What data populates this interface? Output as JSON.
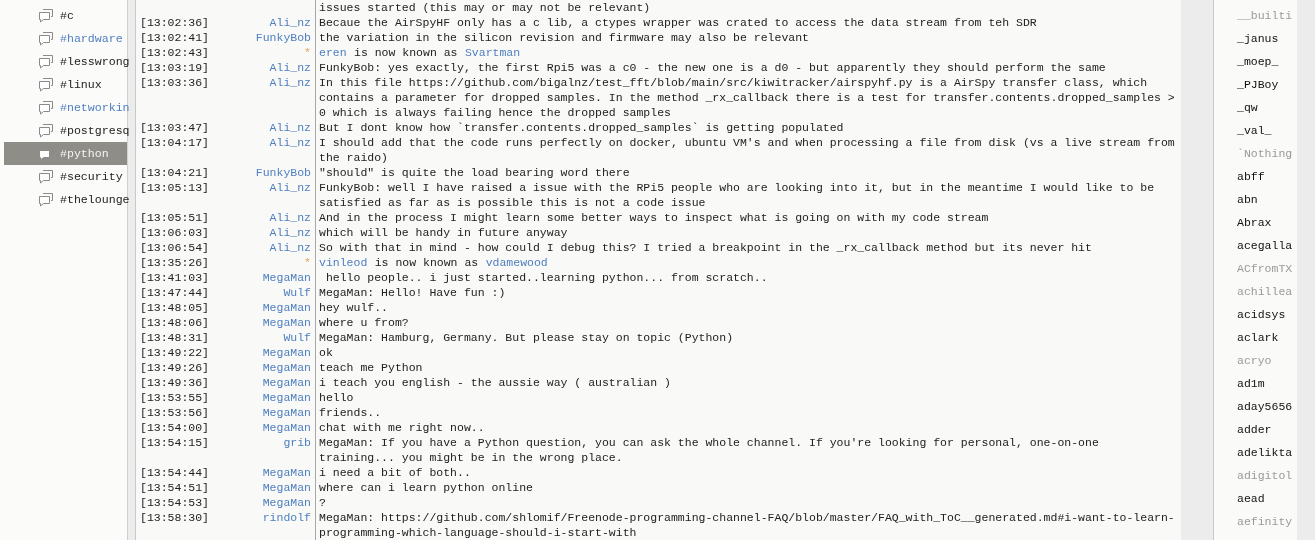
{
  "channels": [
    {
      "name": "#c",
      "highlighted": false,
      "selected": false
    },
    {
      "name": "#hardware",
      "highlighted": true,
      "selected": false
    },
    {
      "name": "#lesswrong",
      "highlighted": false,
      "selected": false
    },
    {
      "name": "#linux",
      "highlighted": false,
      "selected": false
    },
    {
      "name": "#networkin",
      "highlighted": true,
      "selected": false
    },
    {
      "name": "#postgresq",
      "highlighted": false,
      "selected": false
    },
    {
      "name": "#python",
      "highlighted": false,
      "selected": true
    },
    {
      "name": "#security",
      "highlighted": false,
      "selected": false
    },
    {
      "name": "#thelounge",
      "highlighted": false,
      "selected": false
    }
  ],
  "messages": [
    {
      "kind": "continuation",
      "text": "issues started (this may or may not be relevant)"
    },
    {
      "kind": "message",
      "time": "[13:02:36]",
      "nick": "Ali_nz",
      "text": "Becaue the AirSpyHF only has a c lib, a ctypes wrapper was crated to access the data stream from teh SDR"
    },
    {
      "kind": "message",
      "time": "[13:02:41]",
      "nick": "FunkyBob",
      "text": "the variation in the silicon revision and firmware may also be relevant"
    },
    {
      "kind": "nick_change",
      "time": "[13:02:43]",
      "nick": "*",
      "old": "eren",
      "text": "is now known as",
      "new": "Svartman"
    },
    {
      "kind": "message",
      "time": "[13:03:19]",
      "nick": "Ali_nz",
      "text": "FunkyBob: yes exactly, the first Rpi5 was a c0 - the new one is a d0 - but apparently they should perform the same"
    },
    {
      "kind": "message",
      "time": "[13:03:36]",
      "nick": "Ali_nz",
      "text": "In this file https://github.com/bigalnz/test_fft/blob/main/src/kiwitracker/airspyhf.py is a AirSpy transfer class, which contains a parameter for dropped samples. In the method _rx_callback there is a test for transfer.contents.dropped_samples > 0 which is always failing hence the dropped samples"
    },
    {
      "kind": "message",
      "time": "[13:03:47]",
      "nick": "Ali_nz",
      "text": "But I dont know how `transfer.contents.dropped_samples` is getting populated"
    },
    {
      "kind": "message",
      "time": "[13:04:17]",
      "nick": "Ali_nz",
      "text": "I should add that the code runs perfectly on docker, ubuntu VM's and when processing a file from disk (vs a live stream from the raido)"
    },
    {
      "kind": "message",
      "time": "[13:04:21]",
      "nick": "FunkyBob",
      "text": "\"should\" is quite the load bearing word there"
    },
    {
      "kind": "message",
      "time": "[13:05:13]",
      "nick": "Ali_nz",
      "text": "FunkyBob: well I have raised a issue with the RPi5 people who are looking into it, but in the meantime I would like to be satisfied as far as is possible this is not a code issue"
    },
    {
      "kind": "message",
      "time": "[13:05:51]",
      "nick": "Ali_nz",
      "text": "And in the process I might learn some better ways to inspect what is going on with my code stream"
    },
    {
      "kind": "message",
      "time": "[13:06:03]",
      "nick": "Ali_nz",
      "text": "which will be handy in future anyway"
    },
    {
      "kind": "message",
      "time": "[13:06:54]",
      "nick": "Ali_nz",
      "text": "So with that in mind - how could I debug this? I tried a breakpoint in the _rx_callback method but its never hit"
    },
    {
      "kind": "nick_change",
      "time": "[13:35:26]",
      "nick": "*",
      "old": "vinleod",
      "text": "is now known as",
      "new": "vdamewood"
    },
    {
      "kind": "message",
      "time": "[13:41:03]",
      "nick": "MegaMan",
      "text": " hello people.. i just started..learning python... from scratch.."
    },
    {
      "kind": "message",
      "time": "[13:47:44]",
      "nick": "Wulf",
      "text": "MegaMan: Hello! Have fun :)"
    },
    {
      "kind": "message",
      "time": "[13:48:05]",
      "nick": "MegaMan",
      "text": "hey wulf.."
    },
    {
      "kind": "message",
      "time": "[13:48:06]",
      "nick": "MegaMan",
      "text": "where u from?"
    },
    {
      "kind": "message",
      "time": "[13:48:31]",
      "nick": "Wulf",
      "text": "MegaMan: Hamburg, Germany. But please stay on topic (Python)"
    },
    {
      "kind": "message",
      "time": "[13:49:22]",
      "nick": "MegaMan",
      "text": "ok"
    },
    {
      "kind": "message",
      "time": "[13:49:26]",
      "nick": "MegaMan",
      "text": "teach me Python"
    },
    {
      "kind": "message",
      "time": "[13:49:36]",
      "nick": "MegaMan",
      "text": "i teach you english - the aussie way ( australian )"
    },
    {
      "kind": "message",
      "time": "[13:53:55]",
      "nick": "MegaMan",
      "text": "hello"
    },
    {
      "kind": "message",
      "time": "[13:53:56]",
      "nick": "MegaMan",
      "text": "friends.."
    },
    {
      "kind": "message",
      "time": "[13:54:00]",
      "nick": "MegaMan",
      "text": "chat with me right now.."
    },
    {
      "kind": "message",
      "time": "[13:54:15]",
      "nick": "grib",
      "text": "MegaMan: If you have a Python question, you can ask the whole channel. If you're looking for personal, one-on-one training... you might be in the wrong place."
    },
    {
      "kind": "message",
      "time": "[13:54:44]",
      "nick": "MegaMan",
      "text": "i need a bit of both.."
    },
    {
      "kind": "message",
      "time": "[13:54:51]",
      "nick": "MegaMan",
      "text": "where can i learn python online"
    },
    {
      "kind": "message",
      "time": "[13:54:53]",
      "nick": "MegaMan",
      "text": "?"
    },
    {
      "kind": "message",
      "time": "[13:58:30]",
      "nick": "rindolf",
      "text": "MegaMan: https://github.com/shlomif/Freenode-programming-channel-FAQ/blob/master/FAQ_with_ToC__generated.md#i-want-to-learn-programming-which-language-should-i-start-with"
    }
  ],
  "users": [
    {
      "nick": "__builti",
      "away": true
    },
    {
      "nick": "_janus",
      "away": false
    },
    {
      "nick": "_moep_",
      "away": false
    },
    {
      "nick": "_PJBoy",
      "away": false
    },
    {
      "nick": "_qw",
      "away": false
    },
    {
      "nick": "_val_",
      "away": false
    },
    {
      "nick": "`Nothing",
      "away": true
    },
    {
      "nick": "abff",
      "away": false
    },
    {
      "nick": "abn",
      "away": false
    },
    {
      "nick": "Abrax",
      "away": false
    },
    {
      "nick": "acegalla",
      "away": false
    },
    {
      "nick": "ACfromTX",
      "away": true
    },
    {
      "nick": "achillea",
      "away": true
    },
    {
      "nick": "acidsys",
      "away": false
    },
    {
      "nick": "aclark",
      "away": false
    },
    {
      "nick": "acryo",
      "away": true
    },
    {
      "nick": "ad1m",
      "away": false
    },
    {
      "nick": "aday5656",
      "away": false
    },
    {
      "nick": "adder",
      "away": false
    },
    {
      "nick": "adelikta",
      "away": false
    },
    {
      "nick": "adigitol",
      "away": true
    },
    {
      "nick": "aead",
      "away": false
    },
    {
      "nick": "aefinity",
      "away": true
    }
  ]
}
